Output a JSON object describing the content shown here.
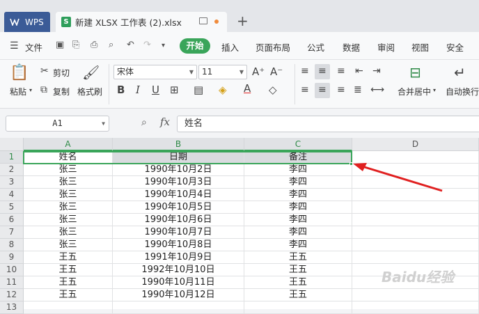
{
  "titlebar": {
    "wps_label": "WPS",
    "doc_title": "新建 XLSX 工作表 (2).xlsx",
    "doc_icon": "S",
    "new_tab": "+"
  },
  "menubar": {
    "file": "文件",
    "items": [
      "开始",
      "插入",
      "页面布局",
      "公式",
      "数据",
      "审阅",
      "视图",
      "安全"
    ],
    "active": "开始"
  },
  "ribbon": {
    "paste": "粘贴",
    "cut": "剪切",
    "copy": "复制",
    "format_painter": "格式刷",
    "font_name": "宋体",
    "font_size": "11",
    "merge_center": "合并居中",
    "auto_wrap": "自动换行"
  },
  "formula_bar": {
    "cell_ref": "A1",
    "fx": "fx",
    "content": "姓名"
  },
  "grid": {
    "columns": [
      "A",
      "B",
      "C",
      "D"
    ],
    "rows": [
      "1",
      "2",
      "3",
      "4",
      "5",
      "6",
      "7",
      "8",
      "9",
      "10",
      "11",
      "12",
      "13"
    ],
    "data": [
      [
        "姓名",
        "日期",
        "备注"
      ],
      [
        "张三",
        "1990年10月2日",
        "李四"
      ],
      [
        "张三",
        "1990年10月3日",
        "李四"
      ],
      [
        "张三",
        "1990年10月4日",
        "李四"
      ],
      [
        "张三",
        "1990年10月5日",
        "李四"
      ],
      [
        "张三",
        "1990年10月6日",
        "李四"
      ],
      [
        "张三",
        "1990年10月7日",
        "李四"
      ],
      [
        "张三",
        "1990年10月8日",
        "李四"
      ],
      [
        "王五",
        "1991年10月9日",
        "王五"
      ],
      [
        "王五",
        "1992年10月10日",
        "王五"
      ],
      [
        "王五",
        "1990年10月11日",
        "王五"
      ],
      [
        "王五",
        "1990年10月12日",
        "王五"
      ]
    ],
    "selected_range": "A1:C1"
  },
  "colors": {
    "accent": "#3aa55a",
    "wps_tab": "#3b5b97",
    "arrow": "#e02020"
  },
  "watermark": "Baidu经验"
}
